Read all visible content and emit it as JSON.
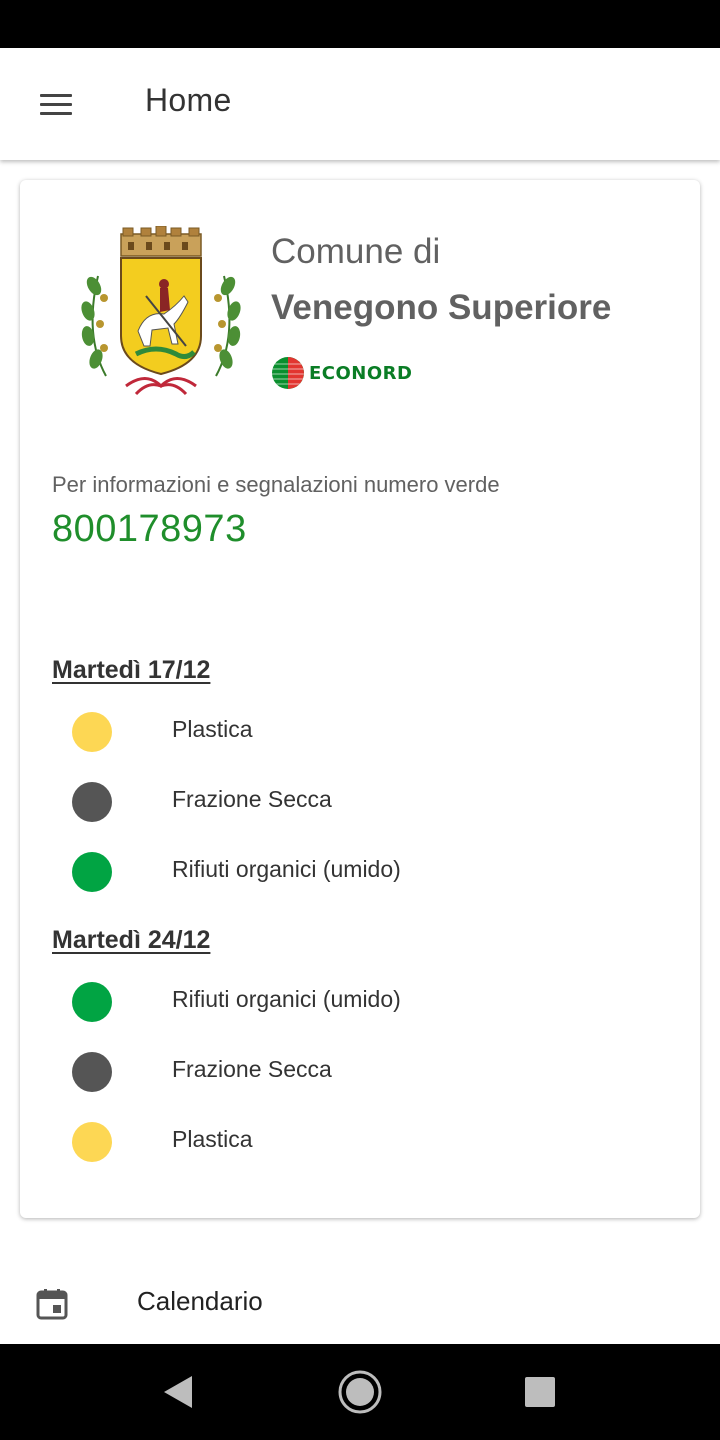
{
  "app_bar": {
    "title": "Home",
    "menu_icon": "menu-icon"
  },
  "header": {
    "prefix": "Comune di",
    "name": "Venegono Superiore",
    "crest_icon": "municipal-crest-icon",
    "partner_logo_text": "ECONORD"
  },
  "info": {
    "label": "Per informazioni e segnalazioni numero verde",
    "phone": "800178973"
  },
  "schedule": [
    {
      "day": "Martedì 17/12",
      "items": [
        {
          "label": "Plastica",
          "color": "#fdd754"
        },
        {
          "label": "Frazione Secca",
          "color": "#555555"
        },
        {
          "label": "Rifiuti organici (umido)",
          "color": "#01a443"
        }
      ]
    },
    {
      "day": "Martedì 24/12",
      "items": [
        {
          "label": "Rifiuti organici (umido)",
          "color": "#01a443"
        },
        {
          "label": "Frazione Secca",
          "color": "#555555"
        },
        {
          "label": "Plastica",
          "color": "#fdd754"
        }
      ]
    }
  ],
  "bottom_menu": {
    "calendar_label": "Calendario",
    "calendar_icon": "calendar-icon"
  },
  "colors": {
    "phone": "#1f8e2b",
    "plastica": "#fdd754",
    "secca": "#555555",
    "umido": "#01a443"
  },
  "system_nav": {
    "back_icon": "back-triangle-icon",
    "home_icon": "home-circle-icon",
    "recents_icon": "recents-square-icon"
  }
}
